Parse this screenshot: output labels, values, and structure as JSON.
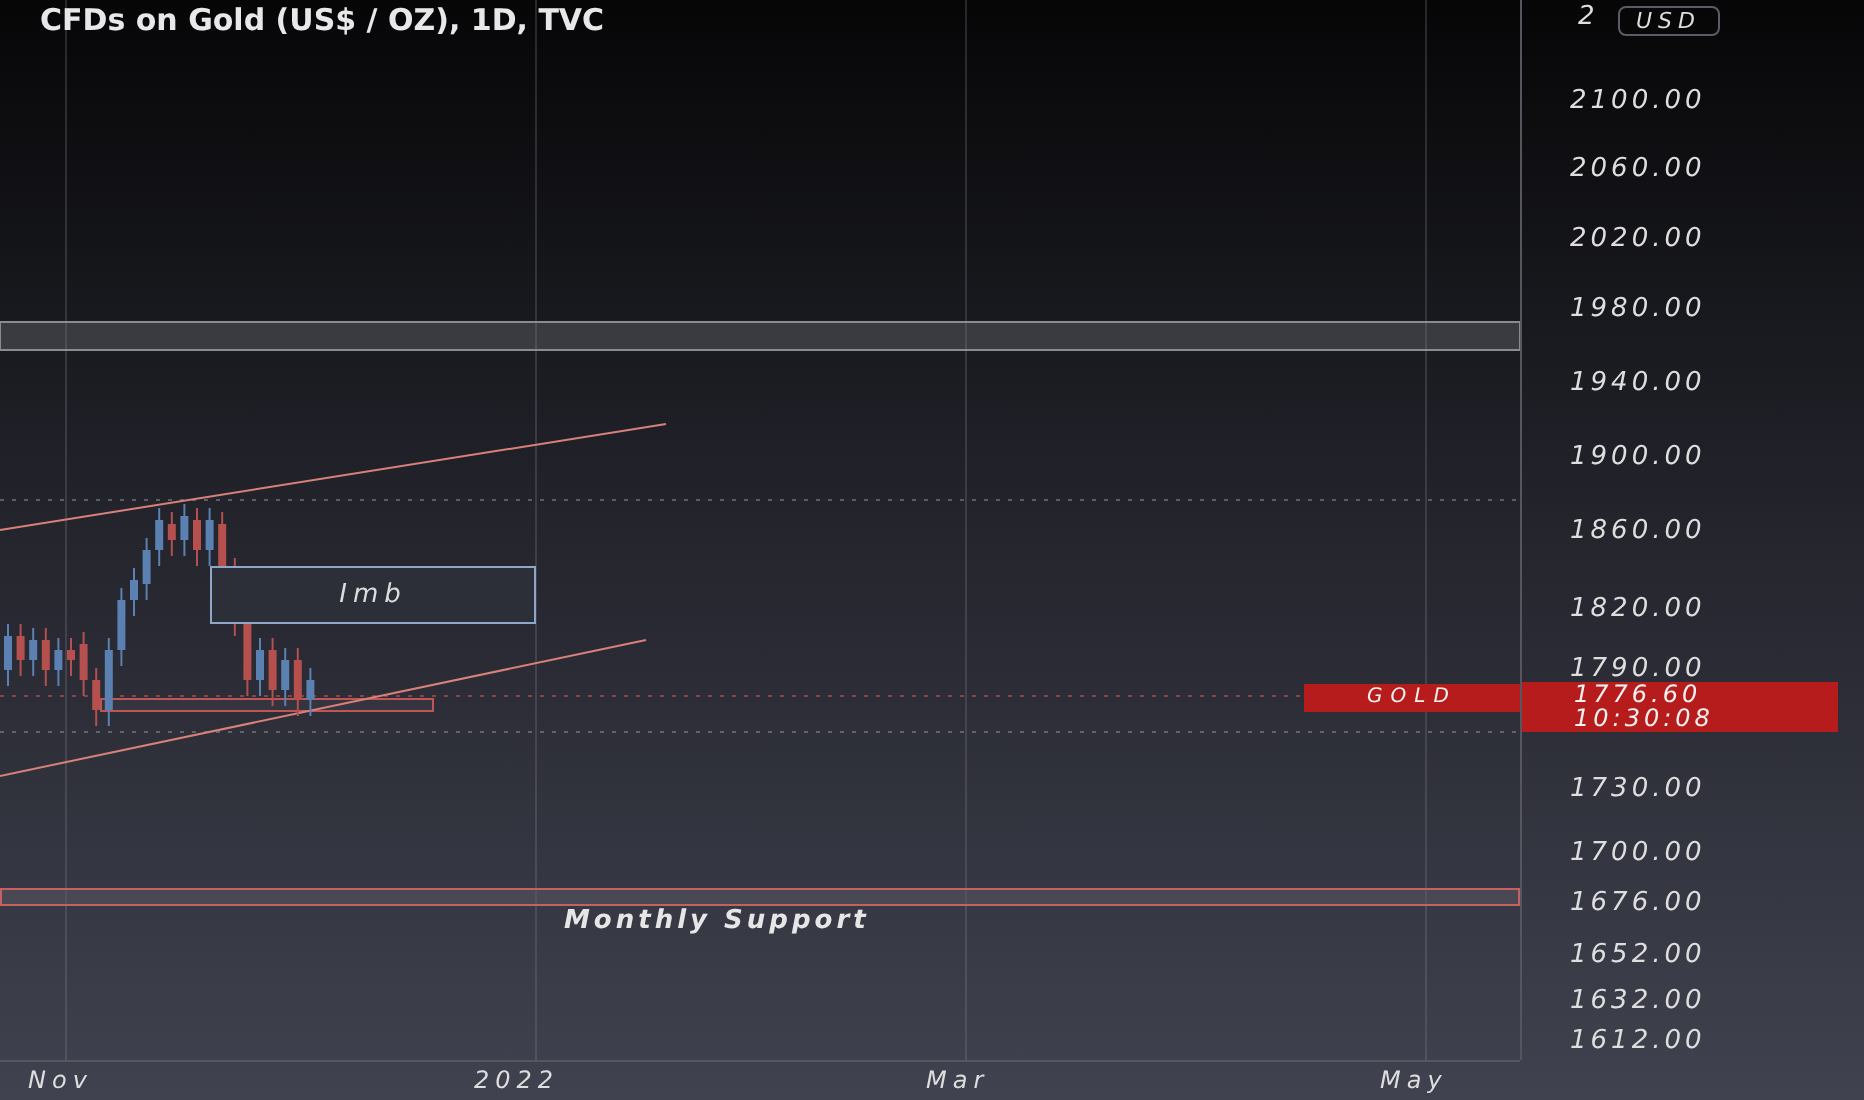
{
  "chart": {
    "title": "CFDs on Gold (US$ / OZ), 1D, TVC",
    "annotations": [
      {
        "kind": "box",
        "text": "Imb"
      },
      {
        "kind": "label",
        "text": "Monthly Support"
      }
    ]
  },
  "price_axis": {
    "top_label": "2",
    "currency": "USD",
    "labels": [
      "2100.00",
      "2060.00",
      "2020.00",
      "1980.00",
      "1940.00",
      "1900.00",
      "1860.00",
      "1820.00",
      "1790.00",
      "1730.00",
      "1700.00",
      "1676.00",
      "1652.00",
      "1632.00",
      "1612.00"
    ]
  },
  "price_tag": {
    "symbol": "GOLD",
    "price": "1776.60",
    "countdown": "10:30:08"
  },
  "time_axis": {
    "labels": [
      "Nov",
      "2022",
      "Mar",
      "May"
    ]
  }
}
